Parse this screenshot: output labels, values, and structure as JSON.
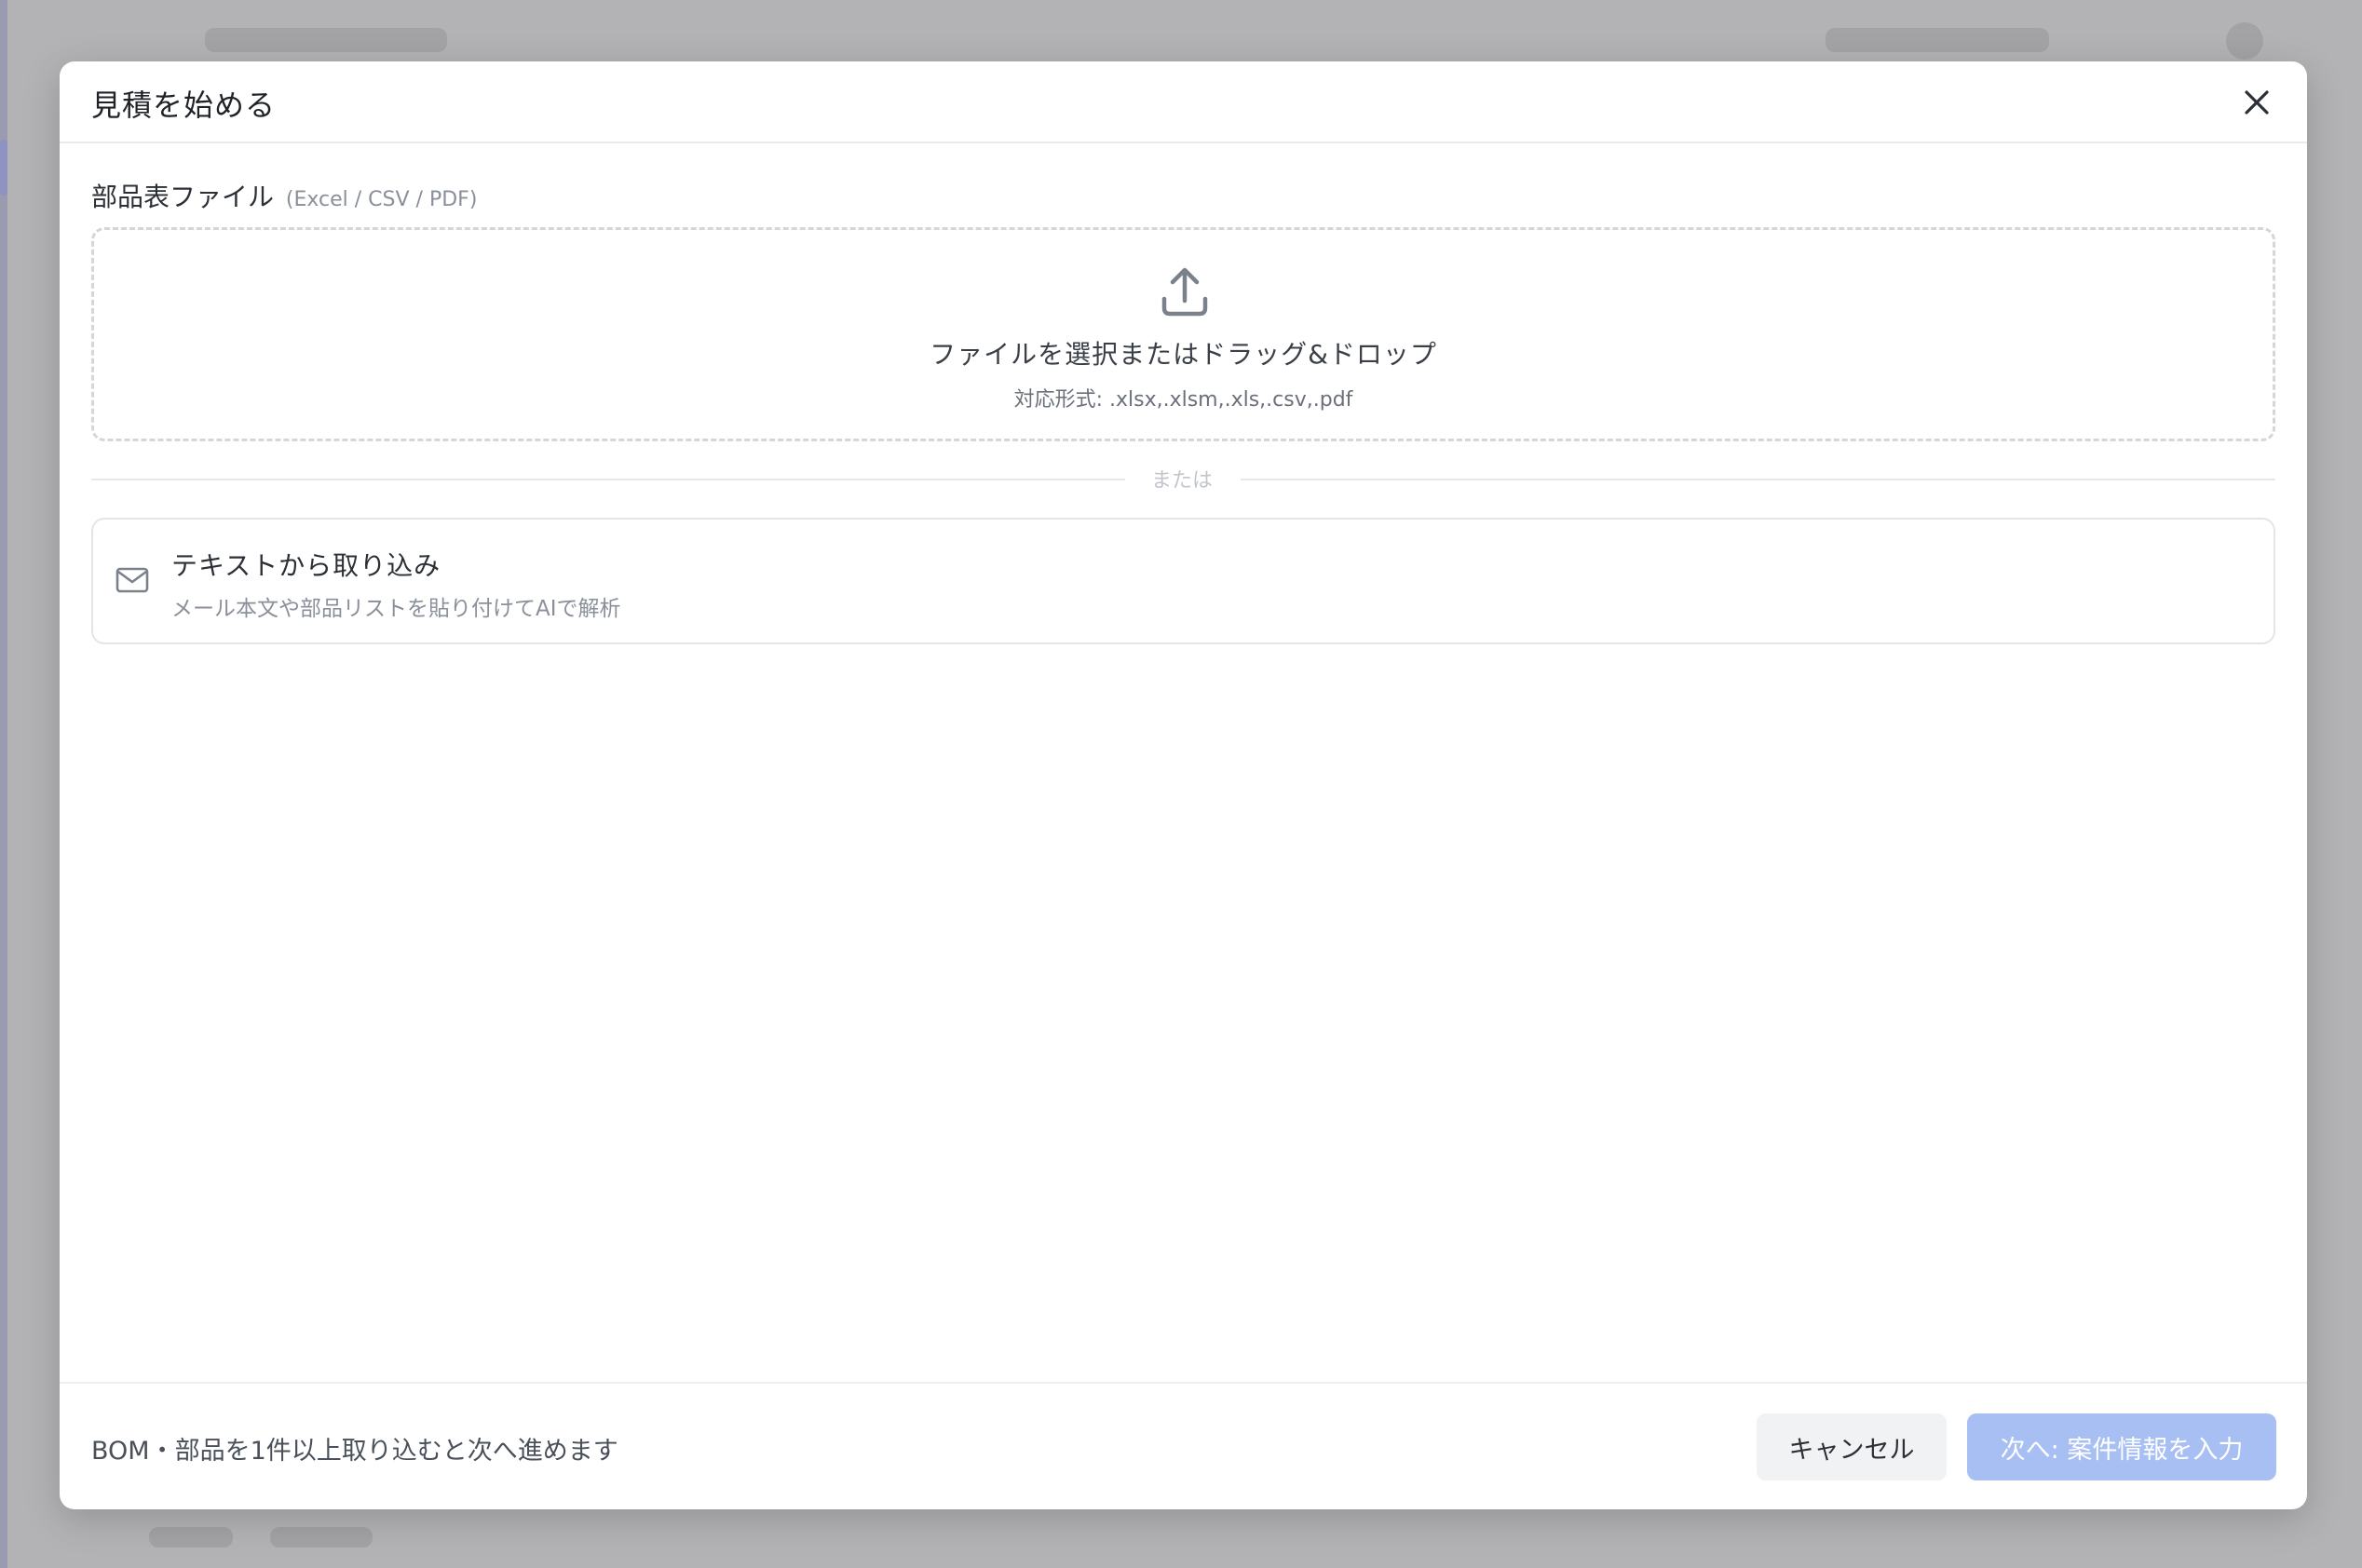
{
  "modal": {
    "title": "見積を始める",
    "close_icon": "close-icon"
  },
  "file_field": {
    "label": "部品表ファイル",
    "formats_hint": "(Excel / CSV / PDF)",
    "dropzone": {
      "icon": "upload-icon",
      "main_text": "ファイルを選択またはドラッグ&ドロップ",
      "sub_text": "対応形式: .xlsx,.xlsm,.xls,.csv,.pdf"
    }
  },
  "divider": {
    "text": "または"
  },
  "text_import": {
    "icon": "mail-icon",
    "title": "テキストから取り込み",
    "description": "メール本文や部品リストを貼り付けてAIで解析"
  },
  "footer": {
    "note": "BOM・部品を1件以上取り込むと次へ進めます",
    "cancel_label": "キャンセル",
    "next_label": "次へ: 案件情報を入力"
  },
  "colors": {
    "backdrop": "#b3b3b5",
    "next_button_disabled": "#a8bff3",
    "cancel_button_bg": "#f1f2f4"
  }
}
